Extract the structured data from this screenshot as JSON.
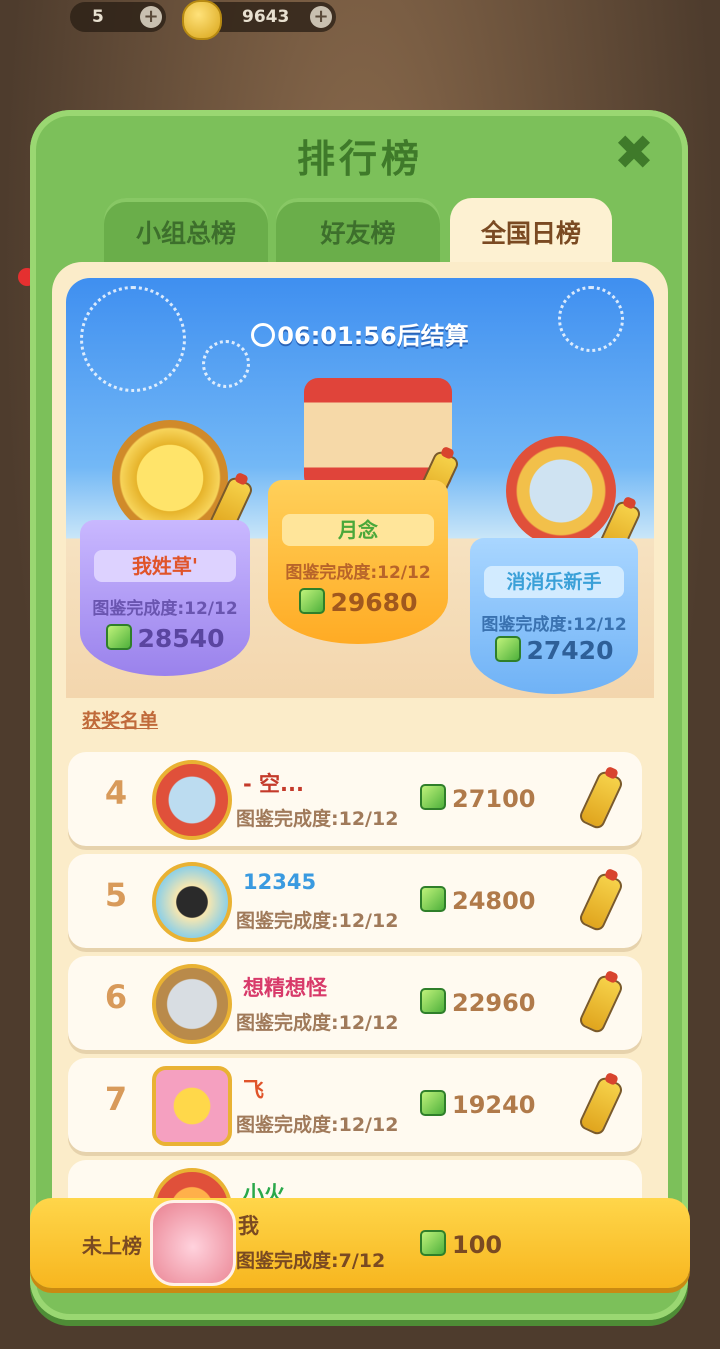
{
  "topbar": {
    "stamina": "5",
    "coins": "9643",
    "plus": "+"
  },
  "panel": {
    "title": "排行榜",
    "close": "✖"
  },
  "tabs": [
    {
      "label": "小组总榜"
    },
    {
      "label": "好友榜"
    },
    {
      "label": "全国日榜"
    }
  ],
  "timer": {
    "text": "06:01:56后结算"
  },
  "podium": {
    "second": {
      "name": "我姓草'",
      "progress": "图鉴完成度:12/12",
      "score": "28540"
    },
    "first": {
      "name": "月念",
      "progress": "图鉴完成度:12/12",
      "score": "29680"
    },
    "third": {
      "name": "消消乐新手",
      "progress": "图鉴完成度:12/12",
      "score": "27420"
    }
  },
  "awards_title": "获奖名单",
  "rows": [
    {
      "rank": "4",
      "name": "- 空...",
      "progress": "图鉴完成度:12/12",
      "score": "27100"
    },
    {
      "rank": "5",
      "name": "12345",
      "progress": "图鉴完成度:12/12",
      "score": "24800"
    },
    {
      "rank": "6",
      "name": "想精想怪",
      "progress": "图鉴完成度:12/12",
      "score": "22960"
    },
    {
      "rank": "7",
      "name": "飞",
      "progress": "图鉴完成度:12/12",
      "score": "19240"
    },
    {
      "rank": "",
      "name": "小火",
      "progress": "",
      "score": ""
    }
  ],
  "me": {
    "label": "未上榜",
    "name": "我",
    "progress": "图鉴完成度:7/12",
    "score": "100"
  },
  "colors": {
    "panel": "#7cc05a",
    "gold": "#ffd64a",
    "purple": "#b9a6f3",
    "orange": "#ffc23a",
    "blue": "#8fc6ff"
  }
}
